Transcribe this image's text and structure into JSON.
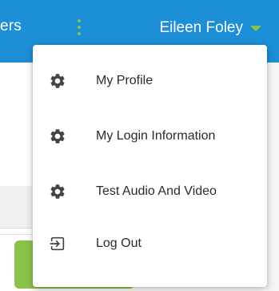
{
  "header": {
    "nav_partial_text": "ers",
    "user_name": "Eileen Foley"
  },
  "menu": {
    "items": [
      {
        "label": "My Profile",
        "icon": "gear-icon"
      },
      {
        "label": "My Login Information",
        "icon": "gear-icon"
      },
      {
        "label": "Test Audio And Video",
        "icon": "gear-icon"
      },
      {
        "label": "Log Out",
        "icon": "logout-icon"
      }
    ]
  },
  "colors": {
    "header_bg": "#1c8fd7",
    "accent_green": "#8bc34a",
    "icon_color": "#444444",
    "text_color": "#2b2b2b"
  }
}
